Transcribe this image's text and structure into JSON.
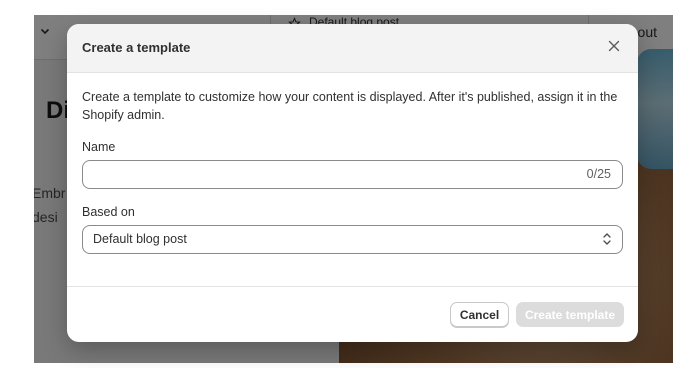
{
  "background": {
    "template_selector": "Default blog post",
    "right_label": "out",
    "heading": "Di",
    "paragraph_lines": [
      "Embr",
      "desi"
    ]
  },
  "modal": {
    "title": "Create a template",
    "description": "Create a template to customize how your content is displayed. After it's published, assign it in the Shopify admin.",
    "name_field": {
      "label": "Name",
      "value": "",
      "char_count": "0/25"
    },
    "based_on_field": {
      "label": "Based on",
      "selected": "Default blog post"
    },
    "buttons": {
      "cancel": "Cancel",
      "create": "Create template"
    }
  },
  "icons": {
    "close": "close-icon",
    "select": "select-arrows-icon",
    "chevron": "chevron-down-icon",
    "star": "star-icon"
  }
}
